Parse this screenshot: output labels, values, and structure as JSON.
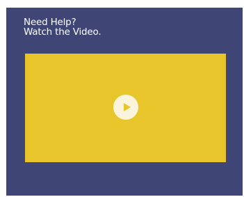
{
  "help_card": {
    "heading_line1": "Need Help?",
    "heading_line2": "Watch the Video.",
    "background_color": "#3f4675"
  },
  "video": {
    "placeholder_color": "#e7c52b",
    "play_button_icon": "play-icon",
    "play_button_color": "#fbf4dc",
    "play_icon_color": "#e7c52b"
  }
}
